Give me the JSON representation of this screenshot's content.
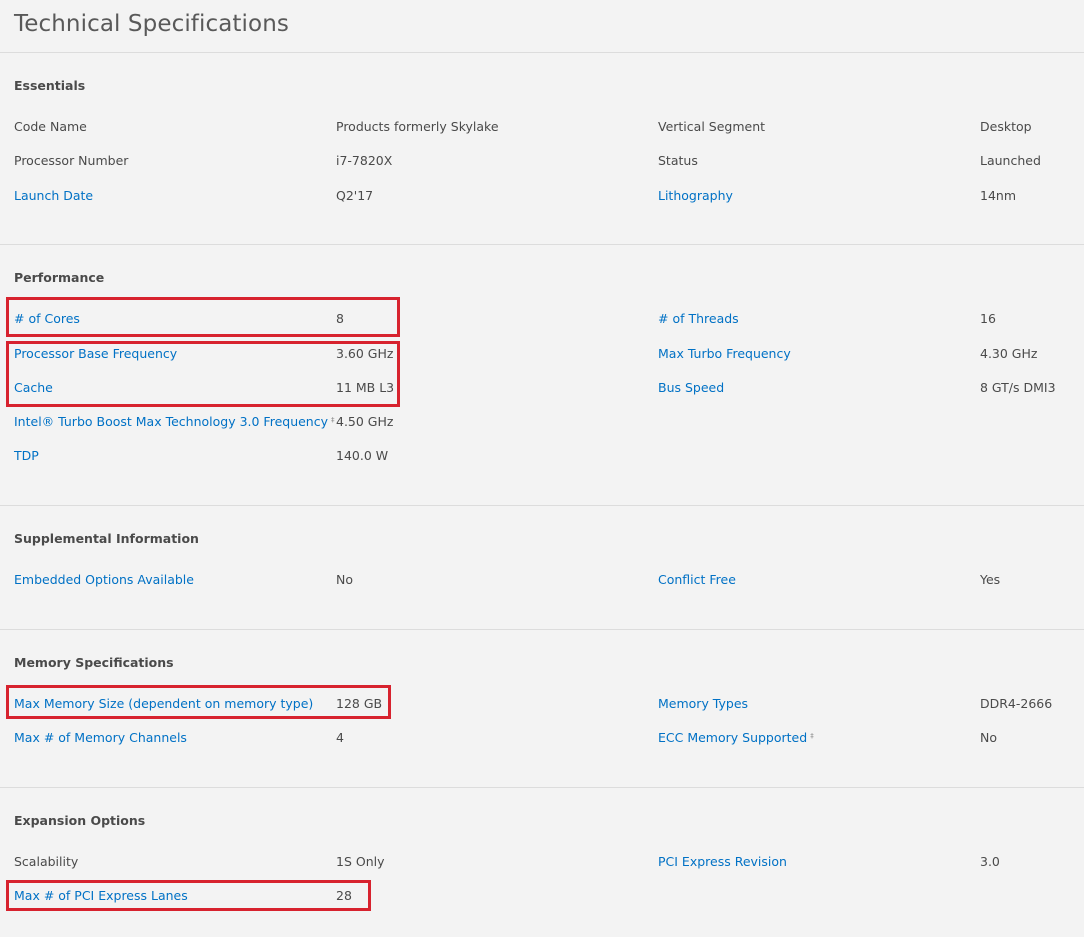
{
  "page_title": "Technical Specifications",
  "colors": {
    "link": "#0071c5",
    "highlight": "#d7222e",
    "background": "#f3f3f3"
  },
  "sections": {
    "essentials": {
      "heading": "Essentials",
      "rows": [
        {
          "l1": "Code Name",
          "v1": "Products formerly Skylake",
          "l2": "Vertical Segment",
          "v2": "Desktop"
        },
        {
          "l1": "Processor Number",
          "v1": "i7-7820X",
          "l2": "Status",
          "v2": "Launched"
        },
        {
          "l1": "Launch Date",
          "v1": "Q2'17",
          "l2": "Lithography",
          "v2": "14nm"
        }
      ]
    },
    "performance": {
      "heading": "Performance",
      "rows": [
        {
          "l1": "# of Cores",
          "v1": "8",
          "l2": "# of Threads",
          "v2": "16"
        },
        {
          "l1": "Processor Base Frequency",
          "v1": "3.60 GHz",
          "l2": "Max Turbo Frequency",
          "v2": "4.30 GHz"
        },
        {
          "l1": "Cache",
          "v1": "11 MB L3",
          "l2": "Bus Speed",
          "v2": "8 GT/s DMI3"
        },
        {
          "l1": "Intel® Turbo Boost Max Technology 3.0 Frequency",
          "v1": "4.50 GHz"
        },
        {
          "l1": "TDP",
          "v1": "140.0 W"
        }
      ]
    },
    "supplemental": {
      "heading": "Supplemental Information",
      "rows": [
        {
          "l1": "Embedded Options Available",
          "v1": "No",
          "l2": "Conflict Free",
          "v2": "Yes"
        }
      ]
    },
    "memory": {
      "heading": "Memory Specifications",
      "rows": [
        {
          "l1": "Max Memory Size (dependent on memory type)",
          "v1": "128 GB",
          "l2": "Memory Types",
          "v2": "DDR4-2666"
        },
        {
          "l1": "Max # of Memory Channels",
          "v1": "4",
          "l2": "ECC Memory Supported",
          "v2": "No"
        }
      ]
    },
    "expansion": {
      "heading": "Expansion Options",
      "rows": [
        {
          "l1": "Scalability",
          "v1": "1S Only",
          "l2": "PCI Express Revision",
          "v2": "3.0"
        },
        {
          "l1": "Max # of PCI Express Lanes",
          "v1": "28"
        }
      ]
    }
  },
  "footnote_mark": "‡"
}
